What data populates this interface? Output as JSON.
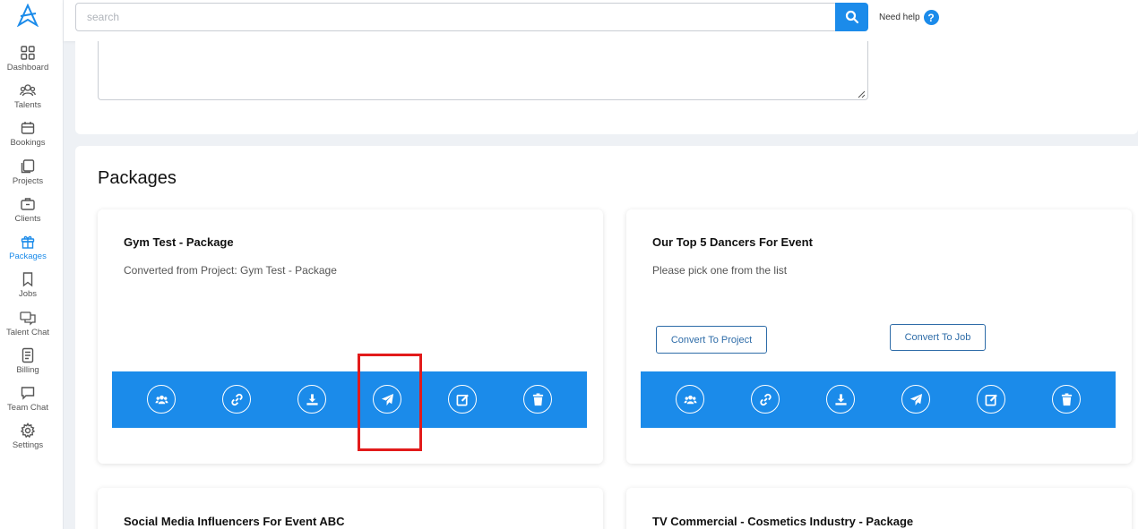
{
  "colors": {
    "accent": "#1b8bea",
    "highlight": "#e21b1b",
    "outline_button": "#2e6ca8"
  },
  "sidebar": {
    "logo": "app-logo",
    "items": [
      {
        "label": "Dashboard",
        "icon": "grid-icon"
      },
      {
        "label": "Talents",
        "icon": "people-icon"
      },
      {
        "label": "Bookings",
        "icon": "calendar-icon"
      },
      {
        "label": "Projects",
        "icon": "copy-icon"
      },
      {
        "label": "Clients",
        "icon": "briefcase-icon"
      },
      {
        "label": "Packages",
        "icon": "gift-icon",
        "active": true
      },
      {
        "label": "Jobs",
        "icon": "bookmark-icon"
      },
      {
        "label": "Talent Chat",
        "icon": "chat-bubbles-icon"
      },
      {
        "label": "Billing",
        "icon": "receipt-icon"
      },
      {
        "label": "Team Chat",
        "icon": "chat-icon"
      },
      {
        "label": "Settings",
        "icon": "gear-icon"
      }
    ]
  },
  "header": {
    "search_placeholder": "search",
    "search_value": "",
    "help_label": "Need help",
    "help_icon_glyph": "?"
  },
  "packages": {
    "title": "Packages",
    "cards": [
      {
        "title": "Gym Test - Package",
        "description": "Converted from Project: Gym Test - Package",
        "actions": [
          "users-icon",
          "link-icon",
          "download-icon",
          "send-icon",
          "edit-icon",
          "trash-icon"
        ]
      },
      {
        "title": "Our Top 5 Dancers For Event",
        "description": "Please pick one from the list",
        "buttons": {
          "convert_project": "Convert To Project",
          "convert_job": "Convert To Job"
        },
        "actions": [
          "users-icon",
          "link-icon",
          "download-icon",
          "send-icon",
          "edit-icon",
          "trash-icon"
        ]
      },
      {
        "title": "Social Media Influencers For Event ABC"
      },
      {
        "title": "TV Commercial - Cosmetics Industry - Package"
      }
    ]
  }
}
